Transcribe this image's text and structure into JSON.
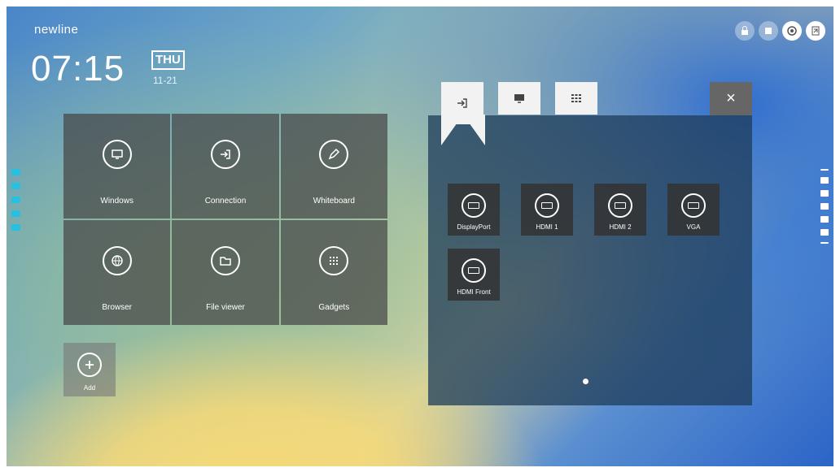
{
  "brand": "newline",
  "clock": {
    "time": "07:15",
    "day": "THU",
    "date": "11-21"
  },
  "top_icons": [
    "lock-icon",
    "record-icon",
    "settings-icon",
    "signal-icon"
  ],
  "apps": [
    {
      "label": "Windows",
      "icon": "pc-icon"
    },
    {
      "label": "Connection",
      "icon": "input-icon"
    },
    {
      "label": "Whiteboard",
      "icon": "pen-icon"
    },
    {
      "label": "Browser",
      "icon": "globe-icon"
    },
    {
      "label": "File viewer",
      "icon": "folder-icon"
    },
    {
      "label": "Gadgets",
      "icon": "grid-icon"
    }
  ],
  "add": {
    "label": "Add"
  },
  "panel": {
    "tabs": [
      "input-source-icon",
      "display-icon",
      "apps-grid-icon"
    ],
    "close": "×",
    "sources": [
      "DisplayPort",
      "HDMI 1",
      "HDMI 2",
      "VGA",
      "HDMI Front"
    ]
  }
}
